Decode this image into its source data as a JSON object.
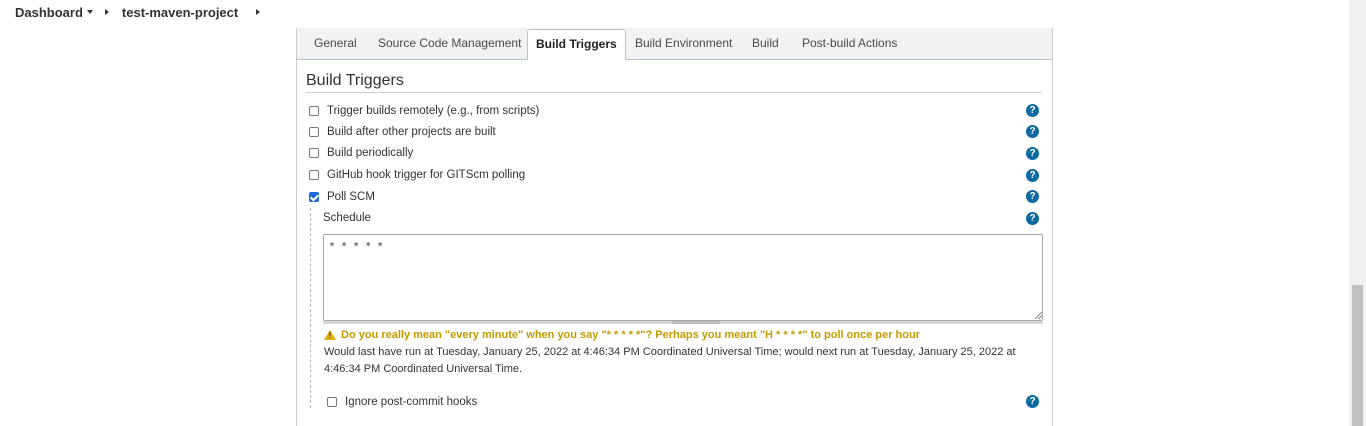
{
  "breadcrumb": {
    "dashboard": "Dashboard",
    "project": "test-maven-project"
  },
  "tabs": [
    {
      "label": "General"
    },
    {
      "label": "Source Code Management"
    },
    {
      "label": "Build Triggers"
    },
    {
      "label": "Build Environment"
    },
    {
      "label": "Build"
    },
    {
      "label": "Post-build Actions"
    }
  ],
  "section": {
    "title": "Build Triggers"
  },
  "triggers": [
    {
      "label": "Trigger builds remotely (e.g., from scripts)",
      "checked": false
    },
    {
      "label": "Build after other projects are built",
      "checked": false
    },
    {
      "label": "Build periodically",
      "checked": false
    },
    {
      "label": "GitHub hook trigger for GITScm polling",
      "checked": false
    },
    {
      "label": "Poll SCM",
      "checked": true
    }
  ],
  "schedule": {
    "label": "Schedule",
    "value": "* * * * *",
    "warning": "Do you really mean \"every minute\" when you say \"* * * * *\"? Perhaps you meant \"H * * * *\" to poll once per hour",
    "info": "Would last have run at Tuesday, January 25, 2022 at 4:46:34 PM Coordinated Universal Time; would next run at Tuesday, January 25, 2022 at 4:46:34 PM Coordinated Universal Time."
  },
  "ignore_hooks": {
    "label": "Ignore post-commit hooks",
    "checked": false
  },
  "help": {
    "glyph": "?"
  },
  "colors": {
    "help_icon": "#0b6aa2",
    "warning_text": "#c49a00",
    "checkbox_checked": "#1e6ad1"
  }
}
